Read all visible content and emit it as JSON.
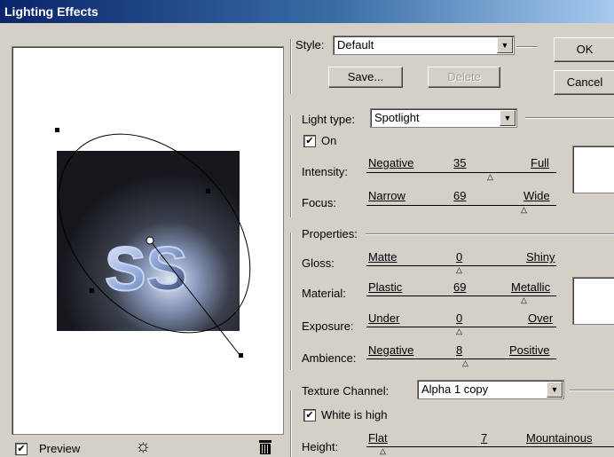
{
  "window": {
    "title": "Lighting Effects"
  },
  "style": {
    "label": "Style:",
    "value": "Default",
    "save": "Save...",
    "delete": "Delete"
  },
  "buttons": {
    "ok": "OK",
    "cancel": "Cancel"
  },
  "light": {
    "type_label": "Light type:",
    "type_value": "Spotlight",
    "on_label": "On",
    "on_checked": true,
    "intensity": {
      "label": "Intensity:",
      "min": "Negative",
      "value": "35",
      "max": "Full",
      "level": 0.55
    },
    "focus": {
      "label": "Focus:",
      "min": "Narrow",
      "value": "69",
      "max": "Wide",
      "level": 0.84
    }
  },
  "properties": {
    "label": "Properties:",
    "gloss": {
      "label": "Gloss:",
      "min": "Matte",
      "value": "0",
      "max": "Shiny",
      "level": 0.5
    },
    "material": {
      "label": "Material:",
      "min": "Plastic",
      "value": "69",
      "max": "Metallic",
      "level": 0.84
    },
    "exposure": {
      "label": "Exposure:",
      "min": "Under",
      "value": "0",
      "max": "Over",
      "level": 0.5
    },
    "ambience": {
      "label": "Ambience:",
      "min": "Negative",
      "value": "8",
      "max": "Positive",
      "level": 0.54
    }
  },
  "texture": {
    "label": "Texture Channel:",
    "channel": "Alpha 1 copy",
    "white_high_label": "White is high",
    "white_high_checked": true,
    "height": {
      "label": "Height:",
      "min": "Flat",
      "value": "7",
      "max": "Mountainous",
      "level": 0.07
    }
  },
  "preview": {
    "label": "Preview",
    "checked": true,
    "image_text": "SS"
  },
  "icons": {
    "light_bulb": "light-bulb-icon",
    "trash": "trash-icon"
  },
  "colors": {
    "title_bar": "#0a246a",
    "dialog_bg": "#d4d0c8",
    "swatch": "#ffffff"
  }
}
